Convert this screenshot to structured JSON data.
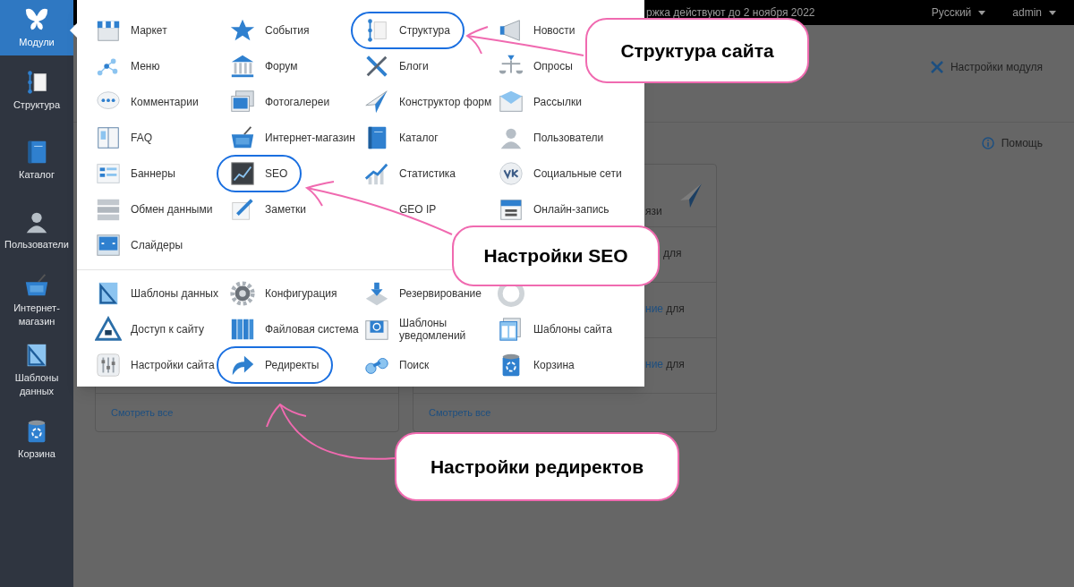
{
  "sidebar": {
    "items": [
      {
        "label": "Модули",
        "selected": true
      },
      {
        "label": "Структура",
        "selected": false
      },
      {
        "label": "Каталог",
        "selected": false
      },
      {
        "label": "Пользователи",
        "selected": false
      },
      {
        "label": "Интернет-магазин",
        "selected": false
      },
      {
        "label": "Шаблоны данных",
        "selected": false
      },
      {
        "label": "Корзина",
        "selected": false
      }
    ]
  },
  "top_bar": {
    "notice": "ржка действуют до 2 ноября 2022",
    "language": "Русский",
    "user": "admin"
  },
  "header": {
    "settings_button": "Настройки модуля"
  },
  "help_link": "Помощь",
  "cards": [
    {
      "footer_link": "Смотреть все"
    },
    {
      "header_text": "язи",
      "rows": [
        {
          "text": "для"
        },
        {
          "link": "ние",
          "text": "для"
        },
        {
          "link": "ние",
          "text": "для"
        }
      ],
      "footer_link": "Смотреть все"
    }
  ],
  "modules_menu": {
    "sections": [
      {
        "items": [
          {
            "label": "Маркет",
            "circled": false
          },
          {
            "label": "События",
            "circled": false
          },
          {
            "label": "Структура",
            "circled": true
          },
          {
            "label": "Новости",
            "circled": false
          },
          {
            "label": "Меню",
            "circled": false
          },
          {
            "label": "Форум",
            "circled": false
          },
          {
            "label": "Блоги",
            "circled": false
          },
          {
            "label": "Опросы",
            "circled": false
          },
          {
            "label": "Комментарии",
            "circled": false
          },
          {
            "label": "Фотогалереи",
            "circled": false
          },
          {
            "label": "Конструктор форм",
            "circled": false
          },
          {
            "label": "Рассылки",
            "circled": false
          },
          {
            "label": "FAQ",
            "circled": false
          },
          {
            "label": "Интернет-магазин",
            "circled": false
          },
          {
            "label": "Каталог",
            "circled": false
          },
          {
            "label": "Пользователи",
            "circled": false
          },
          {
            "label": "Баннеры",
            "circled": false
          },
          {
            "label": "SEO",
            "circled": true
          },
          {
            "label": "Статистика",
            "circled": false
          },
          {
            "label": "Социальные сети",
            "circled": false
          },
          {
            "label": "Обмен данными",
            "circled": false
          },
          {
            "label": "Заметки",
            "circled": false
          },
          {
            "label": "GEO IP",
            "circled": false
          },
          {
            "label": "Онлайн-запись",
            "circled": false
          },
          {
            "label": "Слайдеры",
            "circled": false
          }
        ]
      },
      {
        "items": [
          {
            "label": "Шаблоны данных",
            "circled": false
          },
          {
            "label": "Конфигурация",
            "circled": false
          },
          {
            "label": "Резервирование",
            "circled": false
          },
          {
            "circled": false
          },
          {
            "label": "Доступ к сайту",
            "circled": false
          },
          {
            "label": "Файловая система",
            "circled": false
          },
          {
            "label": "Шаблоны уведомлений",
            "circled": false
          },
          {
            "label": "Шаблоны сайта",
            "circled": false
          },
          {
            "label": "Настройки сайта",
            "circled": false
          },
          {
            "label": "Редиректы",
            "circled": true
          },
          {
            "label": "Поиск",
            "circled": false
          },
          {
            "label": "Корзина",
            "circled": false
          }
        ]
      }
    ]
  },
  "callouts": [
    {
      "text": "Структура сайта"
    },
    {
      "text": "Настройки SEO"
    },
    {
      "text": "Настройки редиректов"
    }
  ]
}
